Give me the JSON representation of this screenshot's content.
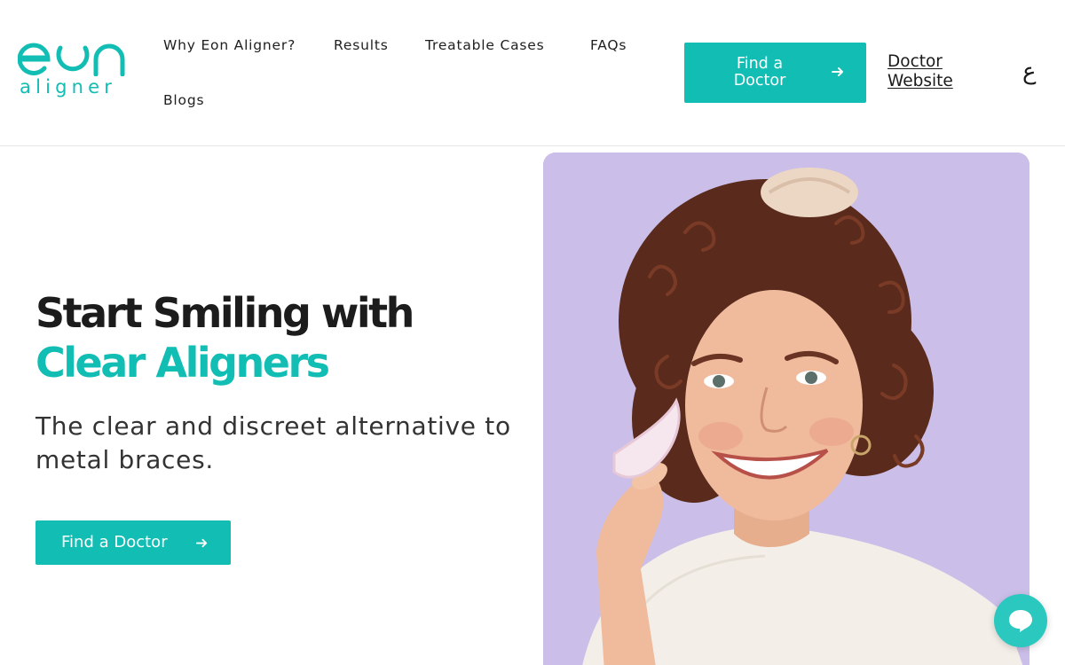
{
  "brand": {
    "logo_top": "eon",
    "logo_bottom": "aligner",
    "color_accent": "#12bdb4",
    "color_image_bg": "#cbbfe9"
  },
  "nav": {
    "why": "Why Eon Aligner?",
    "results": "Results",
    "cases": "Treatable Cases",
    "faqs": "FAQs",
    "blogs": "Blogs"
  },
  "header": {
    "find_line1": "Find a",
    "find_line2": "Doctor",
    "doctor_site_line1": "Doctor",
    "doctor_site_line2": "Website",
    "lang_toggle": "ع",
    "arrow_icon": "arrow-right-icon"
  },
  "hero": {
    "title_line1": "Start Smiling with",
    "title_line2": "Clear Aligners",
    "subtitle": "The clear and discreet alternative to metal braces.",
    "cta": "Find a Doctor",
    "image_icon": "smiling-woman-holding-aligner-photo"
  },
  "chat": {
    "icon": "chat-bubble-icon"
  }
}
